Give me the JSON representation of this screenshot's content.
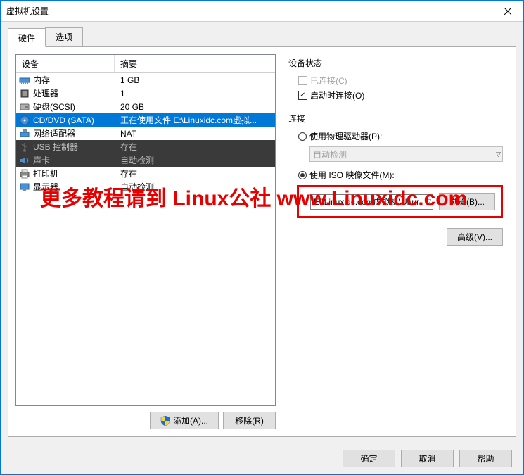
{
  "window": {
    "title": "虚拟机设置"
  },
  "tabs": {
    "hardware": "硬件",
    "options": "选项"
  },
  "table": {
    "header_device": "设备",
    "header_summary": "摘要"
  },
  "devices": [
    {
      "name": "内存",
      "summary": "1 GB",
      "icon": "memory"
    },
    {
      "name": "处理器",
      "summary": "1",
      "icon": "cpu"
    },
    {
      "name": "硬盘(SCSI)",
      "summary": "20 GB",
      "icon": "disk"
    },
    {
      "name": "CD/DVD (SATA)",
      "summary": "正在使用文件 E:\\Linuxidc.com虚拟...",
      "icon": "cd",
      "selected": true
    },
    {
      "name": "网络适配器",
      "summary": "NAT",
      "icon": "network"
    },
    {
      "name": "USB 控制器",
      "summary": "存在",
      "icon": "usb",
      "dark": true
    },
    {
      "name": "声卡",
      "summary": "自动检测",
      "icon": "sound",
      "dark": true
    },
    {
      "name": "打印机",
      "summary": "存在",
      "icon": "printer"
    },
    {
      "name": "显示器",
      "summary": "自动检测",
      "icon": "display"
    }
  ],
  "left_buttons": {
    "add": "添加(A)...",
    "remove": "移除(R)"
  },
  "right": {
    "status_title": "设备状态",
    "connected": "已连接(C)",
    "connect_on_start": "启动时连接(O)",
    "connection_title": "连接",
    "use_physical": "使用物理驱动器(P):",
    "auto_detect": "自动检测",
    "use_iso": "使用 ISO 映像文件(M):",
    "iso_path": "E:\\Linuxidc.com虚拟机\\Ubur",
    "browse": "浏览(B)...",
    "advanced": "高级(V)..."
  },
  "footer": {
    "ok": "确定",
    "cancel": "取消",
    "help": "帮助"
  },
  "watermark": "更多教程请到 Linux公社 www.Linuxidc.com"
}
